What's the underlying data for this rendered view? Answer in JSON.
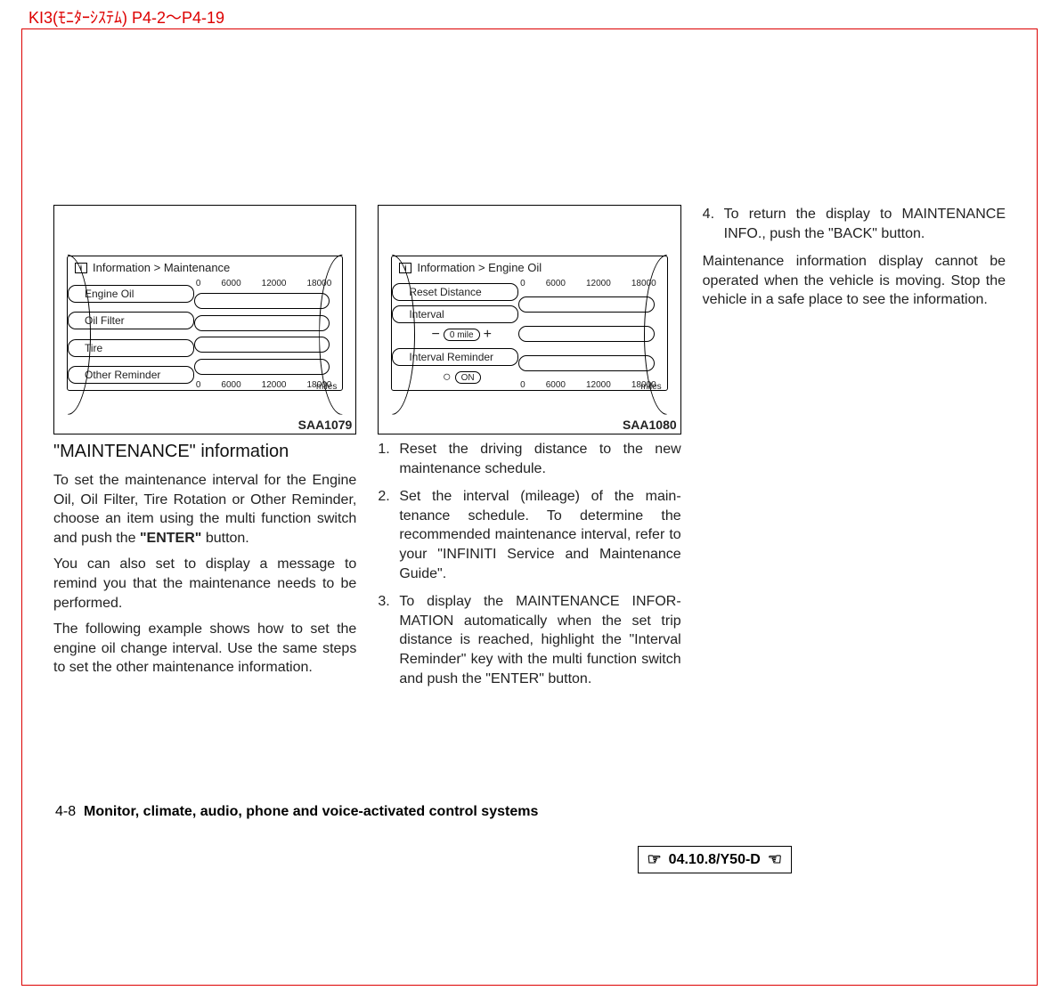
{
  "header": "KI3(ﾓﾆﾀｰｼｽﾃﾑ) P4-2～P4-19",
  "illustration1": {
    "id": "SAA1079",
    "title": "Information > Maintenance",
    "scaleTop": [
      "0",
      "6000",
      "12000",
      "18000"
    ],
    "scaleBot": [
      "0",
      "6000",
      "12000",
      "18000"
    ],
    "milesLabel": "miles",
    "items": [
      "Engine Oil",
      "Oil Filter",
      "Tire",
      "Other Reminder"
    ]
  },
  "illustration2": {
    "id": "SAA1080",
    "title": "Information > Engine Oil",
    "scaleTop": [
      "0",
      "6000",
      "12000",
      "18000"
    ],
    "scaleBot": [
      "0",
      "6000",
      "12000",
      "18000"
    ],
    "milesLabel": "miles",
    "item1": "Reset Distance",
    "item2": "Interval",
    "intervalBtn": "0 mile",
    "item3": "Interval Reminder",
    "onBtn": "ON",
    "minus": "−",
    "plus": "+",
    "circle": "○"
  },
  "col1": {
    "heading": "\"MAINTENANCE\" information",
    "p1a": "To set the maintenance interval for the Engine Oil, Oil Filter, Tire Rotation or Other Reminder, choose an item using the multi function switch and push the ",
    "p1bold1": "\"EN­TER\"",
    "p1b": " button.",
    "p2": "You can also set to display a message to remind you that the maintenance needs to be performed.",
    "p3": "The following example shows how to set the engine oil change interval. Use the same steps to set the other maintenance information."
  },
  "col2": {
    "li1": "Reset the driving distance to the new maintenance schedule.",
    "li2": "Set the interval (mileage) of the main­tenance schedule. To determine the recommended maintenance interval, refer to your \"INFINITI Service and Maintenance Guide\".",
    "li3a": "To display the MAINTENANCE INFOR­MATION automatically when the set trip distance is reached, highlight the ",
    "li3bold1": "\"Interval Reminder\"",
    "li3b": " key with the multi function switch and push the ",
    "li3bold2": "\"ENTER\"",
    "li3c": " button."
  },
  "col3": {
    "li4a": "To return the display to MAINTENANCE INFO., push the ",
    "li4bold": "\"BACK\"",
    "li4b": " button.",
    "p1": "Maintenance information display cannot be operated when the vehicle is moving. Stop the vehicle in a safe place to see the information."
  },
  "footer": {
    "page": "4-8",
    "section": "Monitor, climate, audio, phone and voice-activated control systems"
  },
  "dateStamp": "04.10.8/Y50-D"
}
